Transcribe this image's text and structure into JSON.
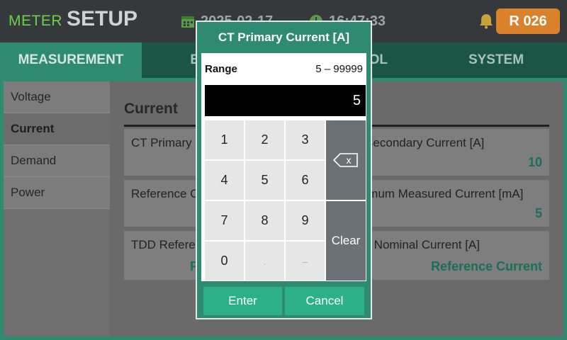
{
  "header": {
    "title_prefix": "METER",
    "title": "SETUP",
    "date": "2025-02-17",
    "time": "16:47:33",
    "badge": "R 026",
    "colors": {
      "accent": "#2f8a72",
      "title_prefix": "#6bd14a",
      "badge": "#d9822b"
    }
  },
  "tabs": [
    {
      "label": "MEASUREMENT"
    },
    {
      "label": "EVENT"
    },
    {
      "label": "CONTROL"
    },
    {
      "label": "SYSTEM"
    }
  ],
  "sidebar": {
    "items": [
      {
        "label": "Voltage"
      },
      {
        "label": "Current"
      },
      {
        "label": "Demand"
      },
      {
        "label": "Power"
      }
    ]
  },
  "section": {
    "title": "Current",
    "fields": [
      {
        "label": "CT Primary Current [A]",
        "value": ""
      },
      {
        "label": "CT Secondary Current [A]",
        "value": "10"
      },
      {
        "label": "Reference Current",
        "value": ""
      },
      {
        "label": "Minimum Measured Current [mA]",
        "value": "5"
      },
      {
        "label": "TDD Reference",
        "value": "Peak"
      },
      {
        "label": "TDD Nominal Current [A]",
        "value": "Reference Current"
      }
    ]
  },
  "dialog": {
    "title": "CT Primary Current [A]",
    "range_label": "Range",
    "range_value": "5 – 99999",
    "display_value": "5",
    "keys": [
      "1",
      "2",
      "3",
      "4",
      "5",
      "6",
      "7",
      "8",
      "9",
      "0",
      ".",
      "–"
    ],
    "backspace_label": "x",
    "clear_label": "Clear",
    "enter_label": "Enter",
    "cancel_label": "Cancel"
  }
}
